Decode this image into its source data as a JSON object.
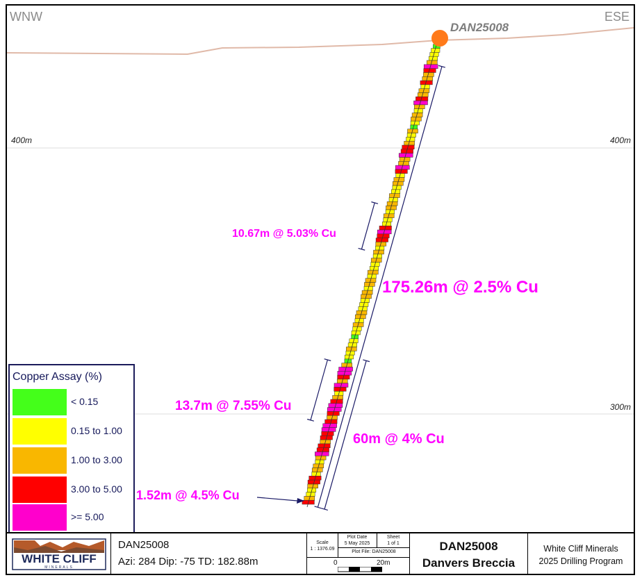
{
  "section": {
    "direction_left": "WNW",
    "direction_right": "ESE",
    "hole_label": "DAN25008",
    "elevation_labels": [
      {
        "text": "400m",
        "level": 400
      },
      {
        "text": "300m",
        "level": 300
      }
    ]
  },
  "intercepts": [
    {
      "text": "10.67m @ 5.03% Cu"
    },
    {
      "text": "175.26m @ 2.5% Cu"
    },
    {
      "text": "13.7m @ 7.55% Cu"
    },
    {
      "text": "60m @ 4% Cu"
    },
    {
      "text": "1.52m @ 4.5% Cu"
    }
  ],
  "legend": {
    "title": "Copper Assay (%)",
    "items": [
      {
        "label": "< 0.15",
        "color": "#44ff1a"
      },
      {
        "label": "0.15 to 1.00",
        "color": "#ffff00"
      },
      {
        "label": "1.00 to 3.00",
        "color": "#f9b700"
      },
      {
        "label": "3.00 to 5.00",
        "color": "#ff0000"
      },
      {
        "label": ">= 5.00",
        "color": "#ff00cc"
      }
    ]
  },
  "title_block": {
    "logo_text": "WHITE CLIFF",
    "logo_subtext": "MINERALS",
    "hole_id": "DAN25008",
    "hole_params": "Azi: 284  Dip: -75  TD: 182.88m",
    "scale_label": "Scale",
    "scale_value": "1 : 1376.09",
    "plot_date_label": "Plot Date",
    "plot_date_value": "5 May 2025",
    "sheet_label": "Sheet",
    "sheet_value": "1 of 1",
    "plot_file": "Plot File: DAN25008",
    "scalebar_start": "0",
    "scalebar_end": "20m",
    "project_line1": "DAN25008",
    "project_line2": "Danvers Breccia",
    "company_line1": "White Cliff Minerals",
    "company_line2": "2025 Drilling Program"
  },
  "assays": [
    0,
    0,
    1,
    1,
    1,
    2,
    4,
    3,
    2,
    2,
    3,
    1,
    2,
    2,
    3,
    4,
    2,
    1,
    2,
    2,
    1,
    0,
    2,
    1,
    1,
    2,
    3,
    3,
    4,
    2,
    2,
    4,
    3,
    1,
    2,
    2,
    1,
    1,
    2,
    1,
    2,
    2,
    1,
    2,
    1,
    1,
    3,
    4,
    3,
    3,
    2,
    1,
    2,
    1,
    2,
    1,
    1,
    2,
    1,
    2,
    2,
    1,
    2,
    2,
    1,
    1,
    1,
    2,
    2,
    1,
    2,
    1,
    1,
    0,
    1,
    1,
    2,
    1,
    1,
    0,
    2,
    4,
    4,
    3,
    2,
    4,
    3,
    1,
    2,
    3,
    4,
    4,
    3,
    2,
    3,
    4,
    4,
    3,
    3,
    2,
    3,
    3,
    4,
    2,
    1,
    2,
    2,
    1,
    3,
    3,
    2,
    1,
    1,
    2,
    3
  ]
}
